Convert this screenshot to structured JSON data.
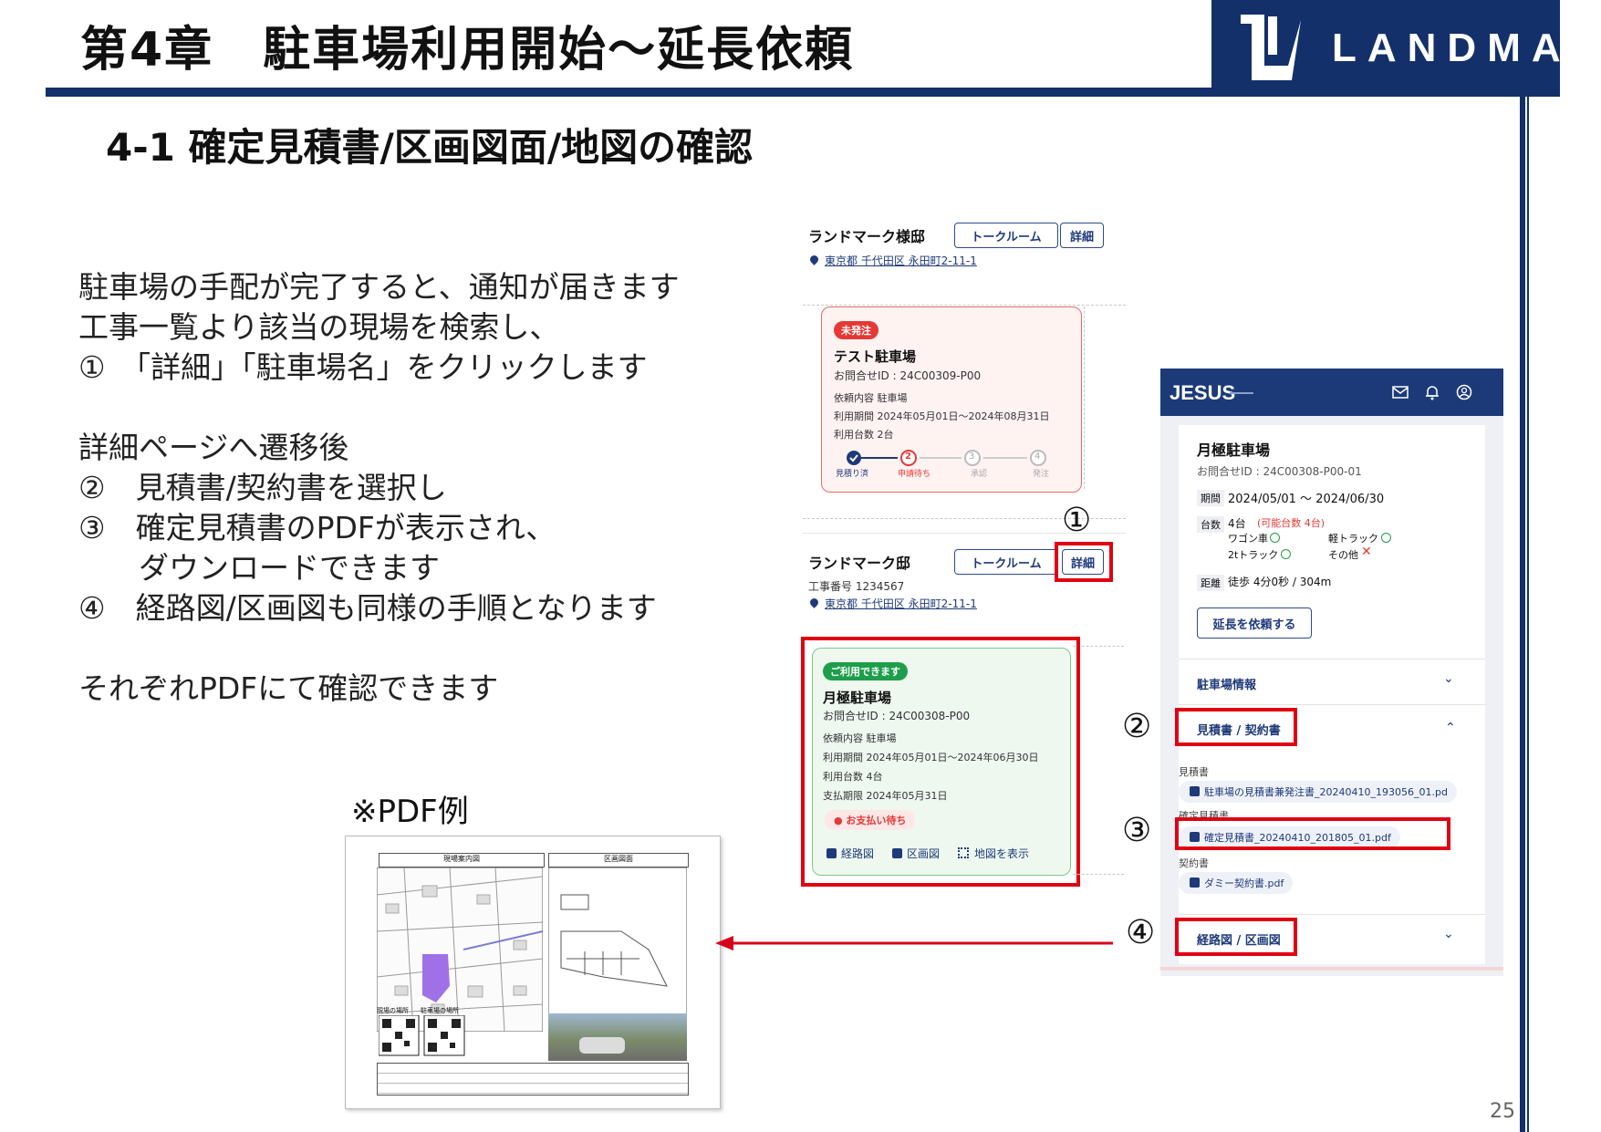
{
  "header": {
    "chapter_title": "第4章　駐車場利用開始～延長依頼",
    "logo_text": "LANDMARK",
    "section_title": "4-1 確定見積書/区画図面/地図の確認"
  },
  "body_text": {
    "lines": [
      "駐車場の手配が完了すると、通知が届きます",
      "工事一覧より該当の現場を検索し、",
      "①　「詳細」「駐車場名」をクリックします",
      "詳細ページへ遷移後",
      "②　見積書/契約書を選択し",
      "③　確定見積書のPDFが表示され、",
      "　　ダウンロードできます",
      "④　経路図/区画図も同様の手順となります",
      "それぞれPDFにて確認できます"
    ],
    "pdf_example_label": "※PDF例"
  },
  "list_panel": {
    "site1": {
      "name": "ランドマーク様邸",
      "talkroom": "トークルーム",
      "detail": "詳細",
      "address": "東京都 千代田区 永田町2-11-1"
    },
    "card1": {
      "badge": "未発注",
      "title": "テスト駐車場",
      "inquiry": "お問合せID : 24C00309-P00",
      "request": "依頼内容  駐車場",
      "period": "利用期間  2024年05月01日～2024年08月31日",
      "count": "利用台数  2台",
      "steps": [
        "見積り済",
        "申請待ち",
        "承認",
        "発注"
      ],
      "step_nums": [
        "2",
        "3",
        "4"
      ]
    },
    "site2": {
      "name": "ランドマーク邸",
      "talkroom": "トークルーム",
      "detail": "詳細",
      "construction_no": "工事番号  1234567",
      "address": "東京都 千代田区 永田町2-11-1"
    },
    "card2": {
      "badge": "ご利用できます",
      "title": "月極駐車場",
      "inquiry": "お問合せID : 24C00308-P00",
      "request": "依頼内容  駐車場",
      "period": "利用期間  2024年05月01日～2024年06月30日",
      "count": "利用台数  4台",
      "due": "支払期限  2024年05月31日",
      "payment_status": "● お支払い待ち",
      "route_map": "経路図",
      "section_map": "区画図",
      "show_map": "地図を表示"
    },
    "markers": [
      "①",
      "②",
      "③",
      "④"
    ]
  },
  "app_panel": {
    "brand": "JESUS",
    "parking_name": "月極駐車場",
    "inquiry": "お問合せID : 24C00308-P00-01",
    "period_label": "期間",
    "period_value": "2024/05/01 ～ 2024/06/30",
    "count_label": "台数",
    "count_value": "4台",
    "count_available": "(可能台数 4台)",
    "vehicles": [
      "ワゴン車",
      "軽トラック",
      "2tトラック",
      "その他"
    ],
    "distance_label": "距離",
    "distance_value": "徒歩 4分0秒 / 304m",
    "extend_button": "延長を依頼する",
    "sec_parking_info": "駐車場情報",
    "sec_estimate_contract": "見積書 / 契約書",
    "estimate_label": "見積書",
    "estimate_file": "駐車場の見積書兼発注書_20240410_193056_01.pd",
    "confirmed_label": "確定見積書",
    "confirmed_file": "確定見積書_20240410_201805_01.pdf",
    "contract_label": "契約書",
    "contract_file": "ダミー契約書.pdf",
    "sec_route_section": "経路図 / 区画図"
  },
  "pdf_preview": {
    "left_header": "現場案内図",
    "right_header": "区画図面",
    "qr_label_1": "現場の場所",
    "qr_label_2": "駐車場の場所"
  },
  "page": {
    "number": "25"
  },
  "colors": {
    "navy": "#13306b",
    "red_highlight": "#e00012",
    "green_badge": "#1e9e4a",
    "red_badge": "#e53935"
  }
}
